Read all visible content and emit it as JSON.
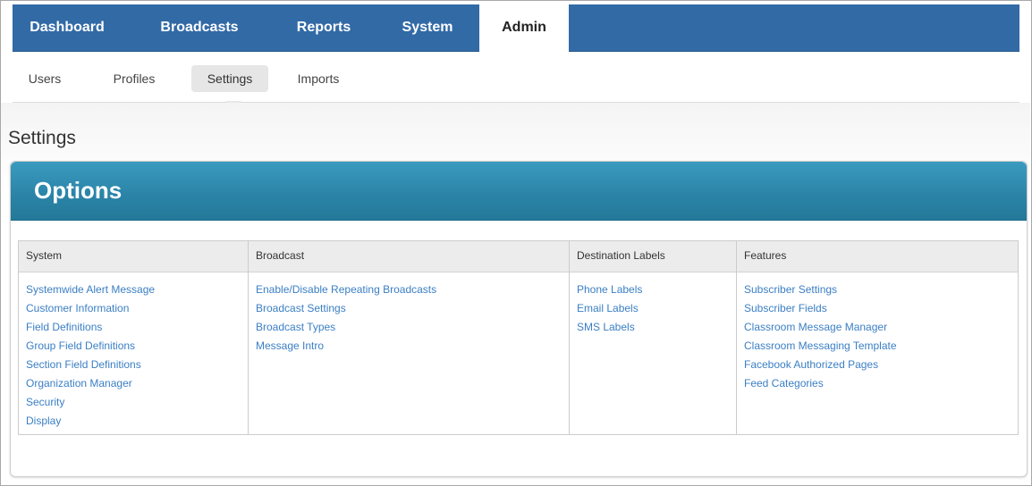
{
  "topnav": {
    "tabs": [
      {
        "label": "Dashboard"
      },
      {
        "label": "Broadcasts"
      },
      {
        "label": "Reports"
      },
      {
        "label": "System"
      },
      {
        "label": "Admin"
      }
    ],
    "active": "Admin"
  },
  "subnav": {
    "tabs": [
      {
        "label": "Users"
      },
      {
        "label": "Profiles"
      },
      {
        "label": "Settings"
      },
      {
        "label": "Imports"
      }
    ],
    "active": "Settings"
  },
  "page": {
    "title": "Settings"
  },
  "options": {
    "title": "Options",
    "columns": [
      {
        "header": "System",
        "links": [
          "Systemwide Alert Message",
          "Customer Information",
          "Field Definitions",
          "Group Field Definitions",
          "Section Field Definitions",
          "Organization Manager",
          "Security",
          "Display"
        ]
      },
      {
        "header": "Broadcast",
        "links": [
          "Enable/Disable Repeating Broadcasts",
          "Broadcast Settings",
          "Broadcast Types",
          "Message Intro"
        ]
      },
      {
        "header": "Destination Labels",
        "links": [
          "Phone Labels",
          "Email Labels",
          "SMS Labels"
        ]
      },
      {
        "header": "Features",
        "links": [
          "Subscriber Settings",
          "Subscriber Fields",
          "Classroom Message Manager",
          "Classroom Messaging Template",
          "Facebook Authorized Pages",
          "Feed Categories"
        ]
      }
    ]
  },
  "colors": {
    "nav_blue": "#326aa6",
    "panel_teal": "#2a83a7",
    "link_blue": "#3b7fc4"
  }
}
